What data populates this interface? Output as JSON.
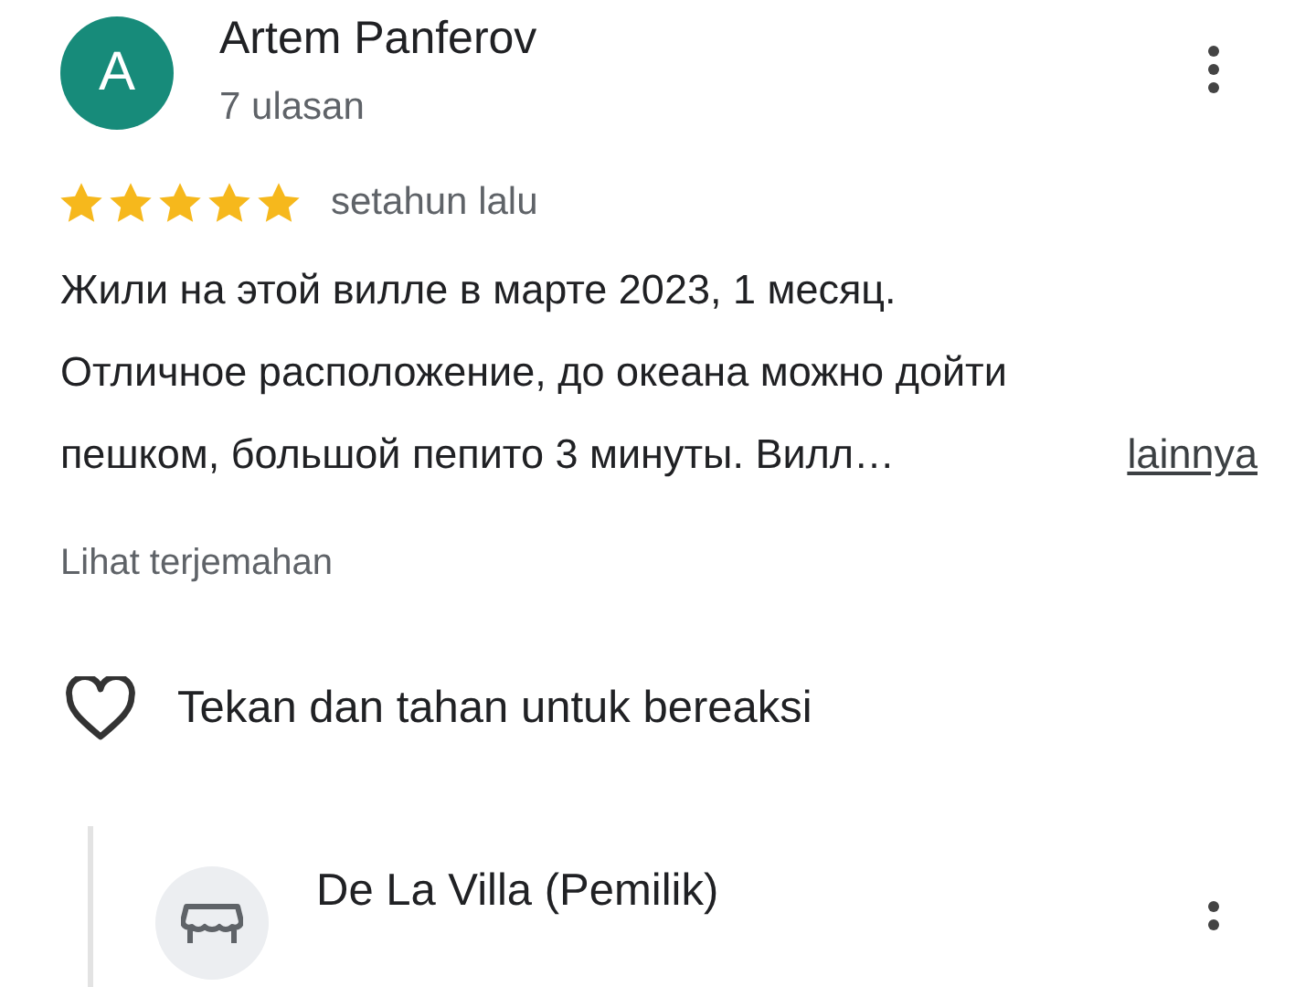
{
  "review": {
    "avatar_letter": "A",
    "author": "Artem Panferov",
    "review_count": "7 ulasan",
    "stars": 5,
    "time": "setahun lalu",
    "text_lines": [
      "Жили на этой вилле в марте 2023, 1 месяц.",
      "Отличное расположение, до океана можно дойти",
      "пешком, большой пепито 3 минуты. Вилл…"
    ],
    "more_link": "lainnya",
    "translate_link": "Lihat terjemahan",
    "react_label": "Tekan dan tahan untuk bereaksi"
  },
  "owner_reply": {
    "author": "De La Villa (Pemilik)"
  }
}
